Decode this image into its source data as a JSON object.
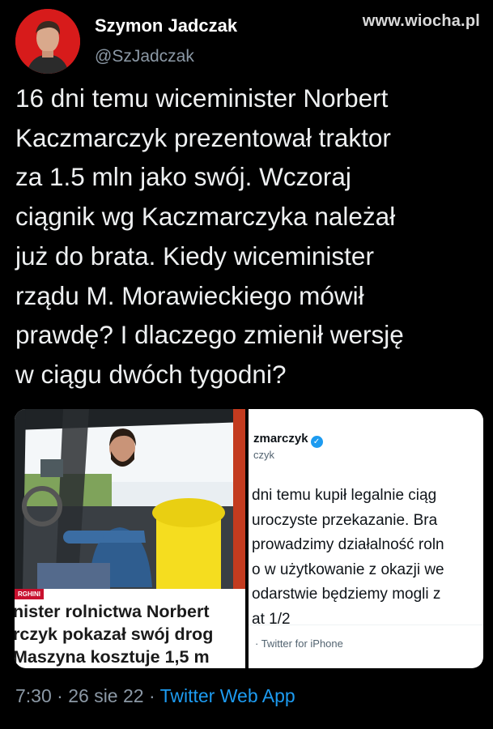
{
  "watermark": "www.wiocha.pl",
  "author": {
    "name": "Szymon Jadczak",
    "handle": "@SzJadczak"
  },
  "tweet_lines": [
    "16 dni temu wiceminister Norbert",
    "Kaczmarczyk prezentował traktor",
    "za 1.5 mln jako swój. Wczoraj",
    "ciągnik wg Kaczmarczyka należał",
    "już do brata. Kiedy wiceminister",
    "rządu M. Morawieckiego mówił",
    "prawdę? I dlaczego zmienił wersję",
    "w ciągu dwóch tygodni?"
  ],
  "news_image": {
    "badge": "RGHINI",
    "headline_lines": [
      "nister rolnictwa Norbert",
      "rczyk pokazał swój drog",
      "Maszyna kosztuje 1,5 m"
    ]
  },
  "embedded_tweet": {
    "name": "zmarczyk",
    "verified_glyph": "✓",
    "handle": "czyk",
    "lines": [
      "dni temu kupił legalnie ciąg",
      "uroczyste przekazanie. Bra",
      "prowadzimy działalność roln",
      "o w użytkowanie z okazji we",
      "odarstwie będziemy mogli z",
      "at 1/2"
    ],
    "source": "· Twitter for iPhone"
  },
  "meta": {
    "time": "7:30",
    "sep1": " · ",
    "date": "26 sie 22",
    "sep2": " · ",
    "app": "Twitter Web App"
  },
  "colors": {
    "background": "#000000",
    "accent": "#1d9bf0",
    "avatar_ring": "#d71b1b",
    "muted": "#8b98a5"
  },
  "icons": [
    "avatar-portrait",
    "verified-badge-icon"
  ]
}
